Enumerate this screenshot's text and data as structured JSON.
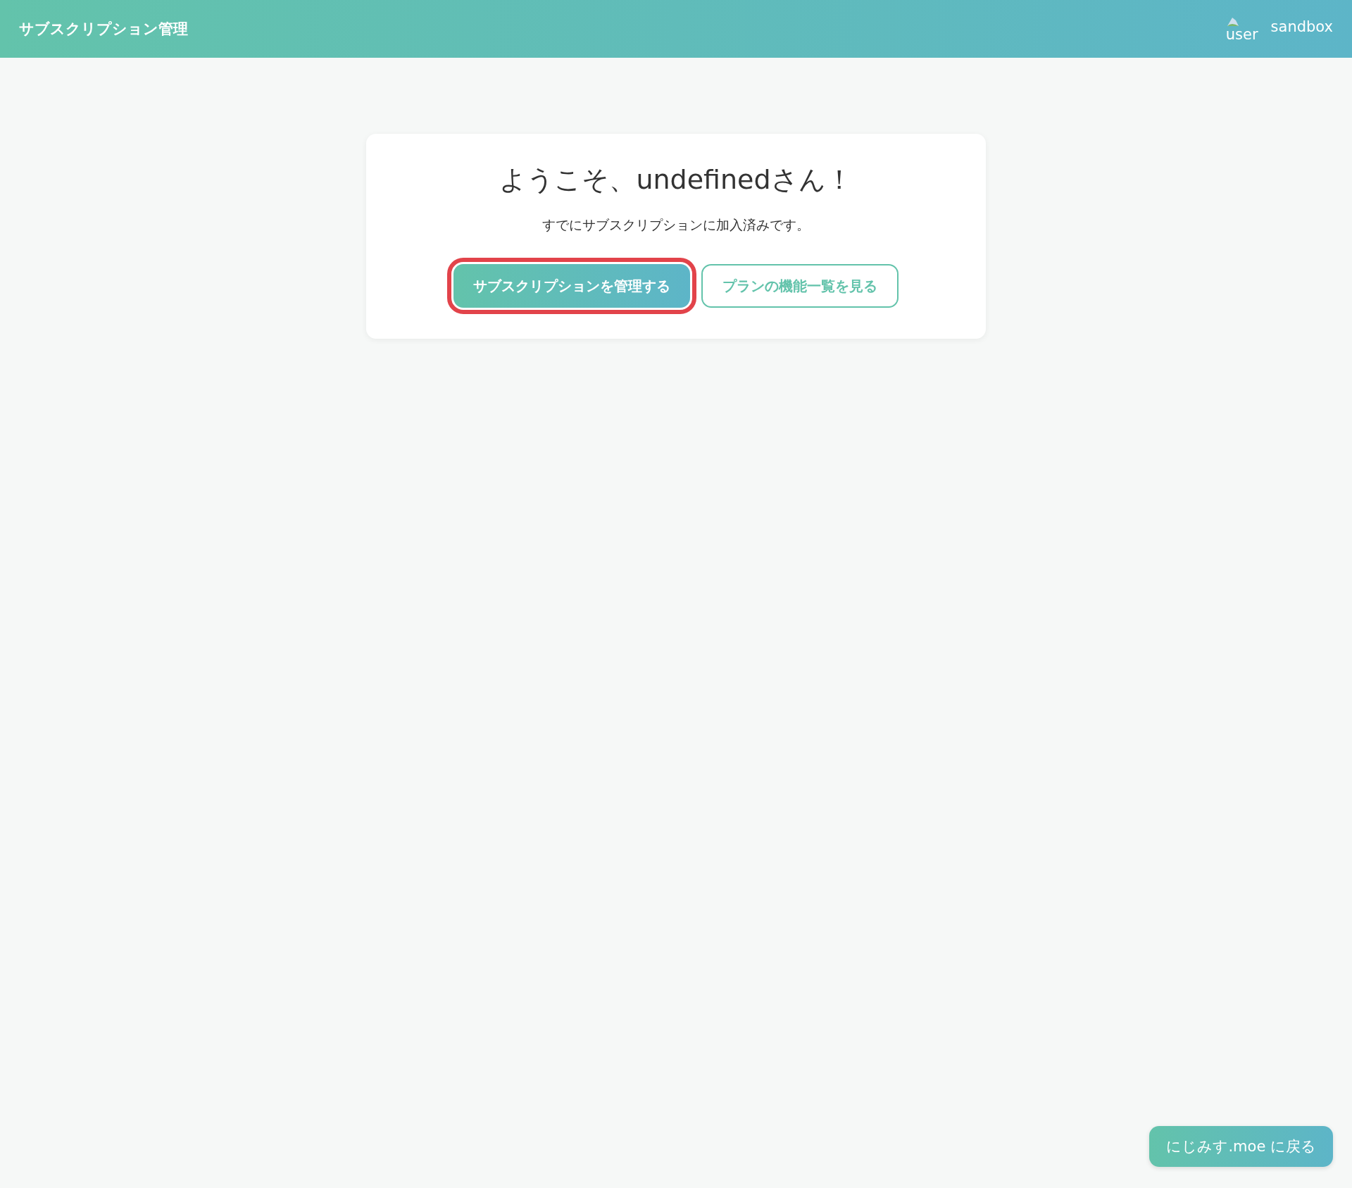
{
  "header": {
    "title": "サブスクリプション管理",
    "user_image_alt": "user",
    "environment": "sandbox"
  },
  "card": {
    "heading": "ようこそ、undefinedさん！",
    "message": "すでにサブスクリプションに加入済みです。",
    "buttons": [
      {
        "kind": "primary",
        "label": "サブスクリプションを管理する",
        "highlighted": true
      },
      {
        "kind": "outline",
        "label": "プランの機能一覧を見る",
        "highlighted": false
      }
    ]
  },
  "back_button": {
    "label": "にじみす.moe に戻る"
  }
}
